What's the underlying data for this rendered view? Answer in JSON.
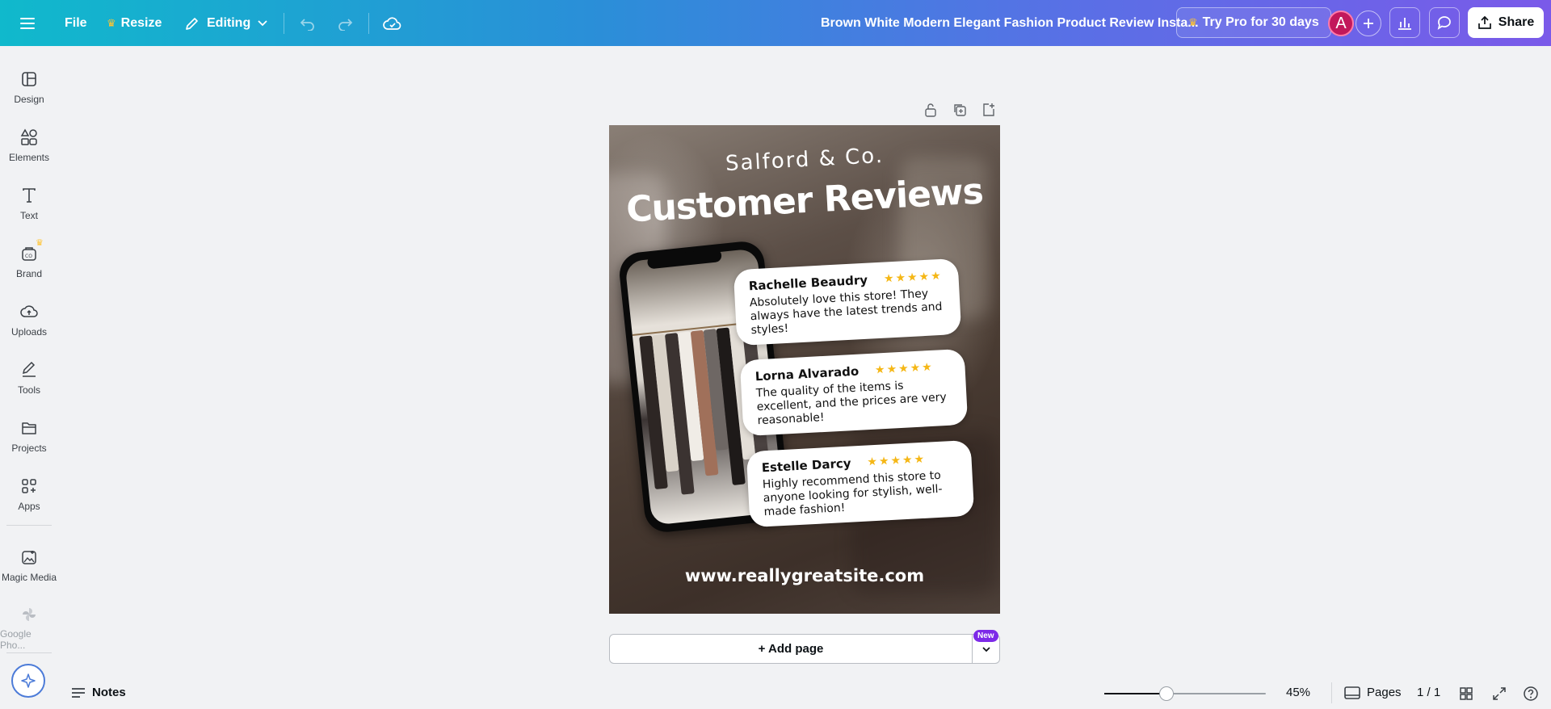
{
  "topbar": {
    "file_label": "File",
    "resize_label": "Resize",
    "editing_label": "Editing",
    "doc_title": "Brown White Modern Elegant Fashion Product Review Insta...",
    "pro_label": "Try Pro for 30 days",
    "avatar_letter": "A",
    "share_label": "Share"
  },
  "rail": {
    "items": [
      {
        "label": "Design",
        "icon": "layout-icon"
      },
      {
        "label": "Elements",
        "icon": "shapes-icon"
      },
      {
        "label": "Text",
        "icon": "text-icon"
      },
      {
        "label": "Brand",
        "icon": "brand-icon"
      },
      {
        "label": "Uploads",
        "icon": "cloud-upload-icon"
      },
      {
        "label": "Tools",
        "icon": "pen-icon"
      },
      {
        "label": "Projects",
        "icon": "folder-icon"
      },
      {
        "label": "Apps",
        "icon": "apps-icon"
      },
      {
        "label": "Magic Media",
        "icon": "magic-media-icon"
      },
      {
        "label": "Google Pho...",
        "icon": "google-photos-icon"
      }
    ]
  },
  "design": {
    "brand": "Salford & Co.",
    "headline": "Customer Reviews",
    "reviews": [
      {
        "name": "Rachelle Beaudry",
        "stars": "★★★★★",
        "text": "Absolutely love this store! They always have the latest trends and styles!"
      },
      {
        "name": "Lorna Alvarado",
        "stars": "★★★★★",
        "text": "The quality of the items is excellent, and the prices are very reasonable!"
      },
      {
        "name": "Estelle Darcy",
        "stars": "★★★★★",
        "text": "Highly recommend this store to anyone looking for stylish, well-made fashion!"
      }
    ],
    "website": "www.reallygreatsite.com"
  },
  "canvas": {
    "add_page_label": "+ Add page",
    "new_badge": "New"
  },
  "bottombar": {
    "notes_label": "Notes",
    "zoom_value": 0.45,
    "zoom_label": "45%",
    "pages_label": "Pages",
    "page_count": "1 / 1"
  },
  "colors": {
    "accent": "#7d2ae8",
    "star": "#f5b716",
    "avatar": "#c2185b"
  }
}
